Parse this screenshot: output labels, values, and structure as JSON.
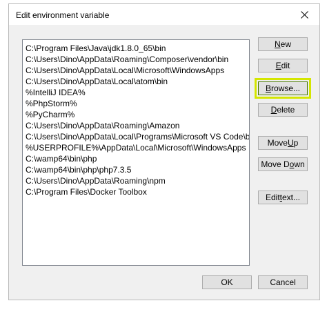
{
  "window": {
    "title": "Edit environment variable",
    "close_icon": "close-icon"
  },
  "paths": [
    "C:\\Program Files\\Java\\jdk1.8.0_65\\bin",
    "C:\\Users\\Dino\\AppData\\Roaming\\Composer\\vendor\\bin",
    "C:\\Users\\Dino\\AppData\\Local\\Microsoft\\WindowsApps",
    "C:\\Users\\Dino\\AppData\\Local\\atom\\bin",
    "%IntelliJ IDEA%",
    "%PhpStorm%",
    "%PyCharm%",
    "C:\\Users\\Dino\\AppData\\Roaming\\Amazon",
    "C:\\Users\\Dino\\AppData\\Local\\Programs\\Microsoft VS Code\\bin",
    "%USERPROFILE%\\AppData\\Local\\Microsoft\\WindowsApps",
    "C:\\wamp64\\bin\\php",
    "C:\\wamp64\\bin\\php\\php7.3.5",
    "C:\\Users\\Dino\\AppData\\Roaming\\npm",
    "C:\\Program Files\\Docker Toolbox"
  ],
  "buttons": {
    "new": {
      "pre": "",
      "key": "N",
      "post": "ew"
    },
    "edit": {
      "pre": "",
      "key": "E",
      "post": "dit"
    },
    "browse": {
      "pre": "",
      "key": "B",
      "post": "rowse..."
    },
    "delete": {
      "pre": "",
      "key": "D",
      "post": "elete"
    },
    "move_up": {
      "pre": "Move ",
      "key": "U",
      "post": "p"
    },
    "move_down": {
      "pre": "Move D",
      "key": "o",
      "post": "wn"
    },
    "edit_text": {
      "pre": "Edit ",
      "key": "t",
      "post": "ext..."
    },
    "ok": "OK",
    "cancel": "Cancel"
  },
  "colors": {
    "highlight": "#d4e600",
    "dialog_bg": "#f0f0f0"
  }
}
